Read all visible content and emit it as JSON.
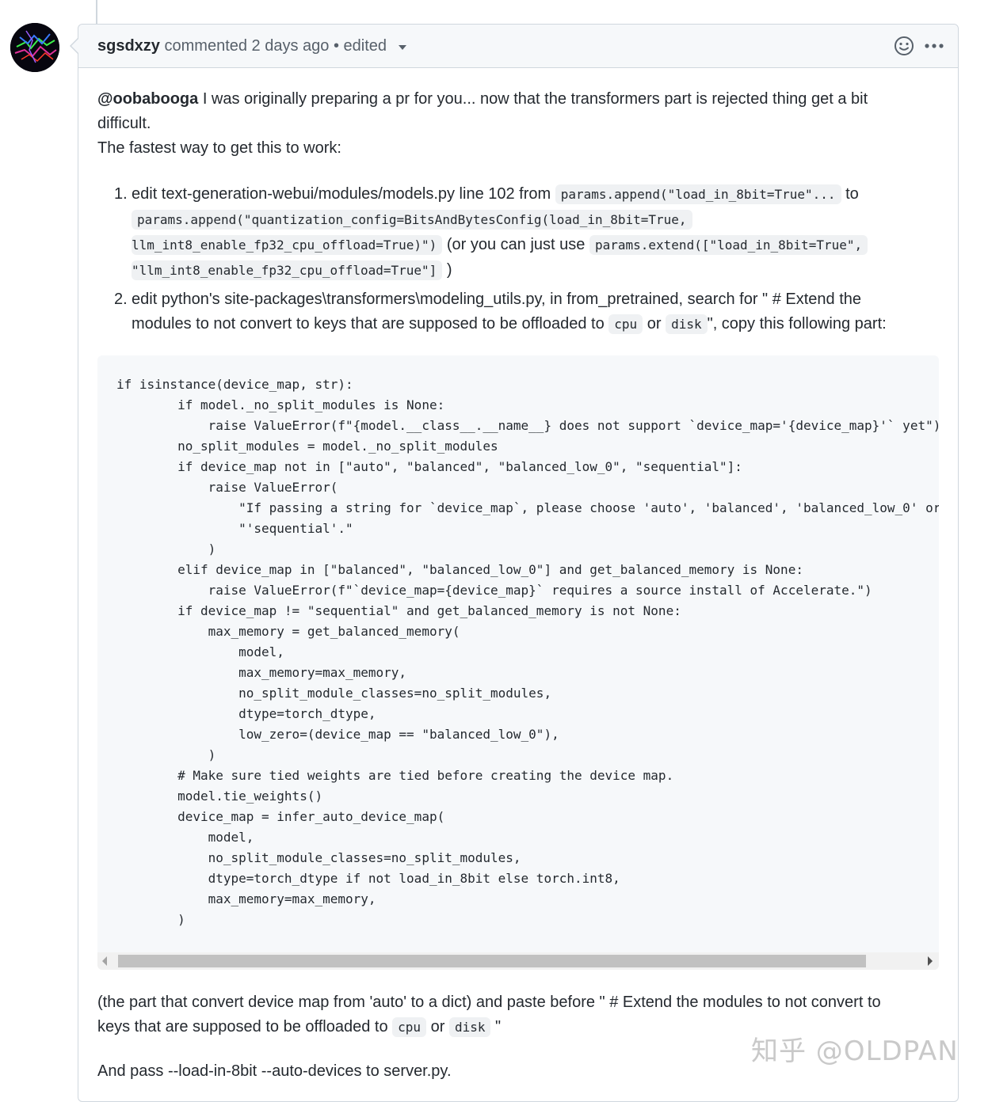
{
  "comment": {
    "author": "sgsdxzy",
    "action_text": "commented 2 days ago • edited",
    "intro_mention": "@oobabooga",
    "intro_line1_rest": " I was originally preparing a pr for you... now that the transformers part is rejected thing get a bit",
    "intro_line2": "difficult.",
    "intro_line3": "The fastest way to get this to work:",
    "step1": {
      "num": "1.",
      "text_a": "edit text-generation-webui/modules/models.py line 102 from ",
      "code_a": "params.append(\"load_in_8bit=True\"...",
      "text_b": " to",
      "code_b1": "params.append(\"quantization_config=BitsAndBytesConfig(load_in_8bit=True,",
      "code_b2": "llm_int8_enable_fp32_cpu_offload=True)\")",
      "text_c": " (or you can just use ",
      "code_c1": "params.extend([\"load_in_8bit=True\",",
      "code_c2": "\"llm_int8_enable_fp32_cpu_offload=True\"]",
      "text_d": " )"
    },
    "step2": {
      "num": "2.",
      "text_a": "edit python's site-packages\\transformers\\modeling_utils.py, in from_pretrained, search for \" # Extend the",
      "text_b": "modules to not convert to keys that are supposed to be offloaded to ",
      "code_cpu": "cpu",
      "text_or": " or ",
      "code_disk": "disk",
      "text_c": "\", copy this following part:"
    },
    "code_snippet": "if isinstance(device_map, str):\n        if model._no_split_modules is None:\n            raise ValueError(f\"{model.__class__.__name__} does not support `device_map='{device_map}'` yet\")\n        no_split_modules = model._no_split_modules\n        if device_map not in [\"auto\", \"balanced\", \"balanced_low_0\", \"sequential\"]:\n            raise ValueError(\n                \"If passing a string for `device_map`, please choose 'auto', 'balanced', 'balanced_low_0' or \"\n                \"'sequential'.\"\n            )\n        elif device_map in [\"balanced\", \"balanced_low_0\"] and get_balanced_memory is None:\n            raise ValueError(f\"`device_map={device_map}` requires a source install of Accelerate.\")\n        if device_map != \"sequential\" and get_balanced_memory is not None:\n            max_memory = get_balanced_memory(\n                model,\n                max_memory=max_memory,\n                no_split_module_classes=no_split_modules,\n                dtype=torch_dtype,\n                low_zero=(device_map == \"balanced_low_0\"),\n            )\n        # Make sure tied weights are tied before creating the device map.\n        model.tie_weights()\n        device_map = infer_auto_device_map(\n            model,\n            no_split_module_classes=no_split_modules,\n            dtype=torch_dtype if not load_in_8bit else torch.int8,\n            max_memory=max_memory,\n        )",
    "outro_line1": "(the part that convert device map from 'auto' to a dict) and paste before \" # Extend the modules to not convert to",
    "outro_line2_a": "keys that are supposed to be offloaded to ",
    "outro_cpu": "cpu",
    "outro_or": " or ",
    "outro_disk": "disk",
    "outro_line2_b": " \"",
    "final_line": "And pass --load-in-8bit --auto-devices to server.py."
  },
  "watermark": "知乎 @OLDPAN",
  "icons": {
    "avatar": "avatar-lightning-image",
    "caret": "chevron-down-icon",
    "emoji": "smiley-icon",
    "more": "kebab-horizontal-icon"
  }
}
